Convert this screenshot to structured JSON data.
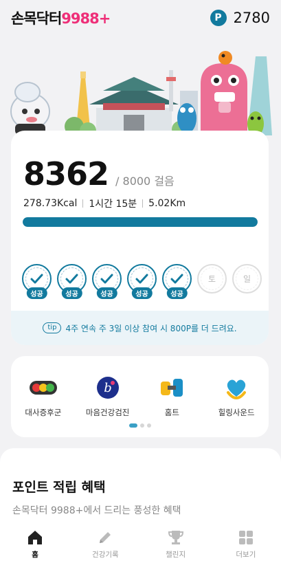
{
  "header": {
    "logo_main": "손목닥터",
    "logo_sub": "9988+",
    "points_icon": "P",
    "points": "2780"
  },
  "steps": {
    "count": "8362",
    "goal_text": "/ 8000 걸음",
    "calories": "278.73Kcal",
    "duration": "1시간 15분",
    "distance": "5.02Km",
    "progress": 1.0
  },
  "week": {
    "success_label": "성공",
    "days": [
      {
        "status": "success"
      },
      {
        "status": "success"
      },
      {
        "status": "success"
      },
      {
        "status": "success"
      },
      {
        "status": "success"
      },
      {
        "status": "empty",
        "label": "토"
      },
      {
        "status": "empty",
        "label": "일"
      }
    ],
    "day_sat": "토",
    "day_sun": "일"
  },
  "tip": {
    "badge": "tip",
    "text": "4주 연속 주 3일 이상 참여 시 800P를 더 드려요."
  },
  "menu": {
    "items": [
      {
        "label": "대사증후군",
        "icon": "traffic-light-icon"
      },
      {
        "label": "마음건강검진",
        "icon": "mind-checkup-icon"
      },
      {
        "label": "홈트",
        "icon": "dumbbell-icon"
      },
      {
        "label": "힐링사운드",
        "icon": "healing-heart-icon"
      }
    ]
  },
  "benefits": {
    "title": "포인트 적립 혜택",
    "subtitle": "손목닥터 9988+에서 드리는 풍성한 혜택"
  },
  "tabs": [
    {
      "label": "홈",
      "icon": "home-icon",
      "active": true
    },
    {
      "label": "건강기록",
      "icon": "pencil-icon",
      "active": false
    },
    {
      "label": "챌린지",
      "icon": "trophy-icon",
      "active": false
    },
    {
      "label": "더보기",
      "icon": "grid-icon",
      "active": false
    }
  ],
  "colors": {
    "accent": "#127a9e",
    "brand_pink": "#ee2f78",
    "success_tag": "#127a9e"
  }
}
